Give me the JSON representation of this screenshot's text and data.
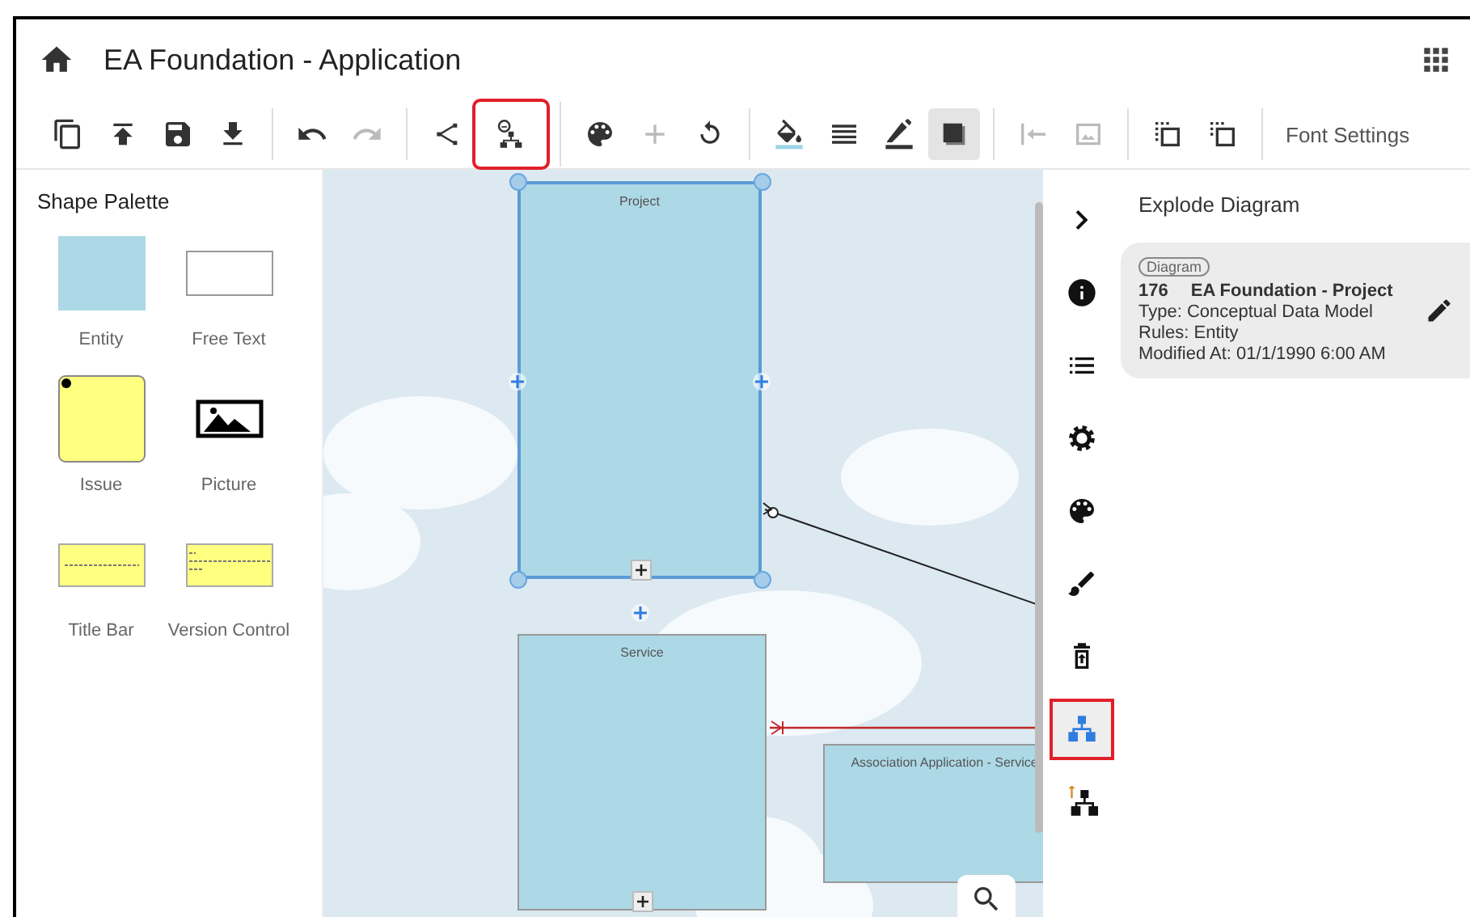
{
  "window": {
    "title": "EA Foundation - Application"
  },
  "toolbar": {
    "groups": [
      [
        {
          "disabled": false,
          "selected": false,
          "highlighted": false
        },
        {
          "disabled": false,
          "selected": false,
          "highlighted": false
        },
        {
          "disabled": false,
          "selected": false,
          "highlighted": false
        },
        {
          "disabled": false,
          "selected": false,
          "highlighted": false
        }
      ],
      [
        {
          "disabled": false,
          "selected": false,
          "highlighted": false
        },
        {
          "disabled": true,
          "selected": false,
          "highlighted": false
        }
      ],
      [
        {
          "disabled": false,
          "selected": false,
          "highlighted": false
        },
        {
          "disabled": false,
          "selected": false,
          "highlighted": true
        }
      ],
      [
        {
          "disabled": false,
          "selected": false,
          "highlighted": false
        },
        {
          "disabled": true,
          "selected": false,
          "highlighted": false
        },
        {
          "disabled": false,
          "selected": false,
          "highlighted": false
        }
      ],
      [
        {
          "disabled": false,
          "selected": false,
          "highlighted": false
        },
        {
          "disabled": false,
          "selected": false,
          "highlighted": false
        },
        {
          "disabled": false,
          "selected": false,
          "highlighted": false
        },
        {
          "disabled": false,
          "selected": true,
          "highlighted": false
        }
      ],
      [
        {
          "disabled": true,
          "selected": false,
          "highlighted": false
        },
        {
          "disabled": true,
          "selected": false,
          "highlighted": false
        }
      ],
      [
        {
          "disabled": false,
          "selected": false,
          "highlighted": false
        },
        {
          "disabled": false,
          "selected": false,
          "highlighted": false
        }
      ]
    ],
    "font_settings": "Font Settings"
  },
  "palette": {
    "title": "Shape Palette",
    "items": [
      {
        "kind": "entity",
        "label": "Entity"
      },
      {
        "kind": "free_text",
        "label": "Free Text"
      },
      {
        "kind": "issue",
        "label": "Issue"
      },
      {
        "kind": "picture",
        "label": "Picture"
      },
      {
        "kind": "title_bar",
        "label": "Title Bar"
      },
      {
        "kind": "version_control",
        "label": "Version Control"
      }
    ]
  },
  "canvas": {
    "entities": [
      {
        "name": "Project",
        "selected": true
      },
      {
        "name": "Service",
        "selected": false
      },
      {
        "name": "Association Application - Service",
        "selected": false
      }
    ]
  },
  "rail": {
    "items": [
      {
        "selected": false,
        "highlighted": false
      },
      {
        "selected": false,
        "highlighted": false
      },
      {
        "selected": false,
        "highlighted": false
      },
      {
        "selected": false,
        "highlighted": false
      },
      {
        "selected": false,
        "highlighted": false
      },
      {
        "selected": false,
        "highlighted": false
      },
      {
        "selected": true,
        "highlighted": true
      },
      {
        "selected": false,
        "highlighted": false
      }
    ]
  },
  "panel": {
    "title": "Explode Diagram",
    "card": {
      "tag": "Diagram",
      "id": "176",
      "name": "EA Foundation - Project",
      "type": "Type: Conceptual Data Model",
      "rules": "Rules: Entity",
      "modified": "Modified At: 01/1/1990 6:00 AM"
    }
  }
}
